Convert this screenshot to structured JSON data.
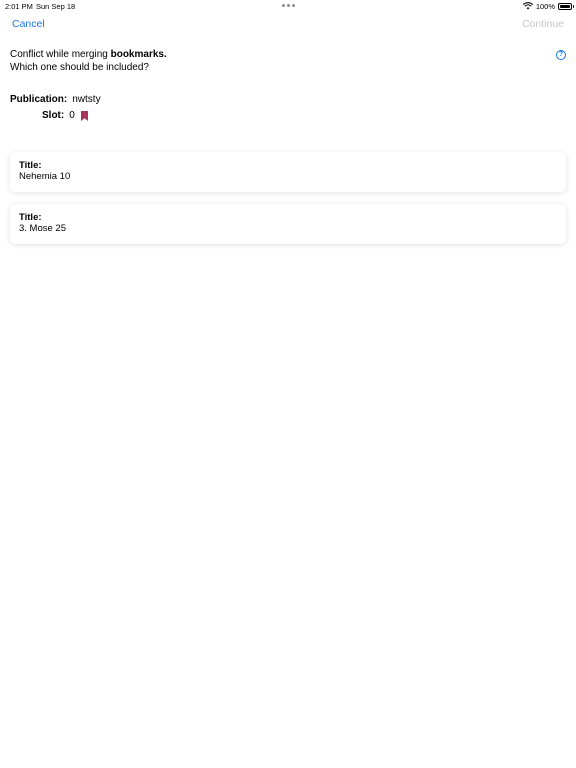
{
  "status_bar": {
    "time": "2:01 PM",
    "date": "Sun Sep 18",
    "battery": "100%"
  },
  "nav": {
    "cancel_label": "Cancel",
    "continue_label": "Continue"
  },
  "conflict": {
    "line1_prefix": "Conflict while merging ",
    "line1_bold": "bookmarks.",
    "line2": "Which one should be included?"
  },
  "help_icon_glyph": "?",
  "details": {
    "publication_label": "Publication:",
    "publication_value": "nwtsty",
    "slot_label": "Slot:",
    "slot_value": "0"
  },
  "options": [
    {
      "title_label": "Title:",
      "title_value": "Nehemia 10"
    },
    {
      "title_label": "Title:",
      "title_value": "3. Mose 25"
    }
  ],
  "colors": {
    "accent": "#1877e6",
    "disabled": "#c7c7cc",
    "bookmark": "#a8355a"
  }
}
